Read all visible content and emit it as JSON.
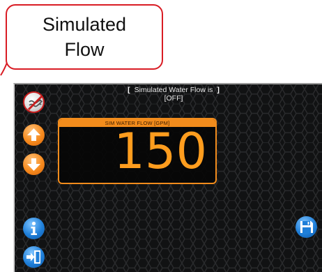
{
  "callout": {
    "line1": "Simulated",
    "line2": "Flow"
  },
  "status": {
    "line1": "Simulated Water Flow is",
    "line2": "[OFF]",
    "bracket_left": "[",
    "bracket_right": "]"
  },
  "flow_panel": {
    "label": "SIM WATER FLOW [GPM]",
    "value": "150"
  },
  "buttons": {
    "flow_toggle_icon": "water-flow-off-icon",
    "increase_icon": "arrow-up-icon",
    "decrease_icon": "arrow-down-icon",
    "info_icon": "info-icon",
    "exit_icon": "exit-door-icon",
    "save_icon": "floppy-disk-icon"
  },
  "colors": {
    "callout_border": "#d91c24",
    "accent_orange": "#f28c1c",
    "value_orange": "#ff9d1e",
    "button_blue": "#1f7fd9",
    "button_orange": "#f68a1e",
    "screen_background": "#101112"
  }
}
